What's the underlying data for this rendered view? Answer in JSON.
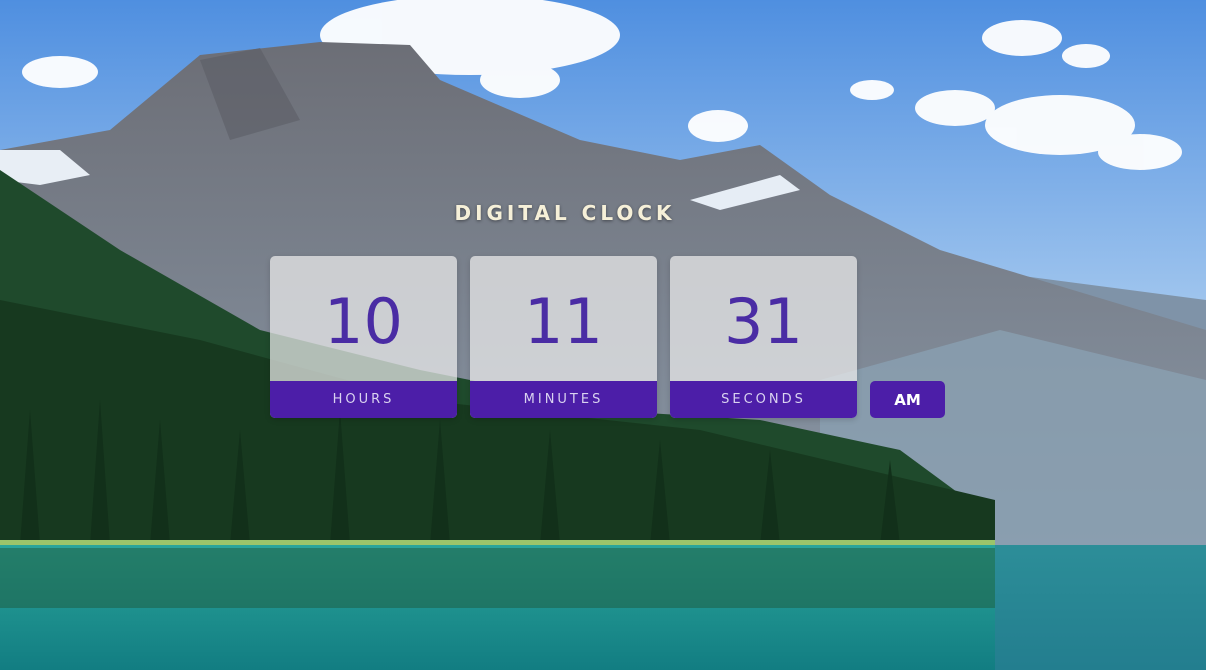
{
  "clock": {
    "title": "DIGITAL CLOCK",
    "hours": {
      "value": "10",
      "label": "HOURS"
    },
    "minutes": {
      "value": "11",
      "label": "MINUTES"
    },
    "seconds": {
      "value": "31",
      "label": "SECONDS"
    },
    "period": "AM"
  },
  "colors": {
    "accent": "#4c1ea8",
    "digit": "#4a2ca4",
    "title": "#f6f0d8"
  }
}
